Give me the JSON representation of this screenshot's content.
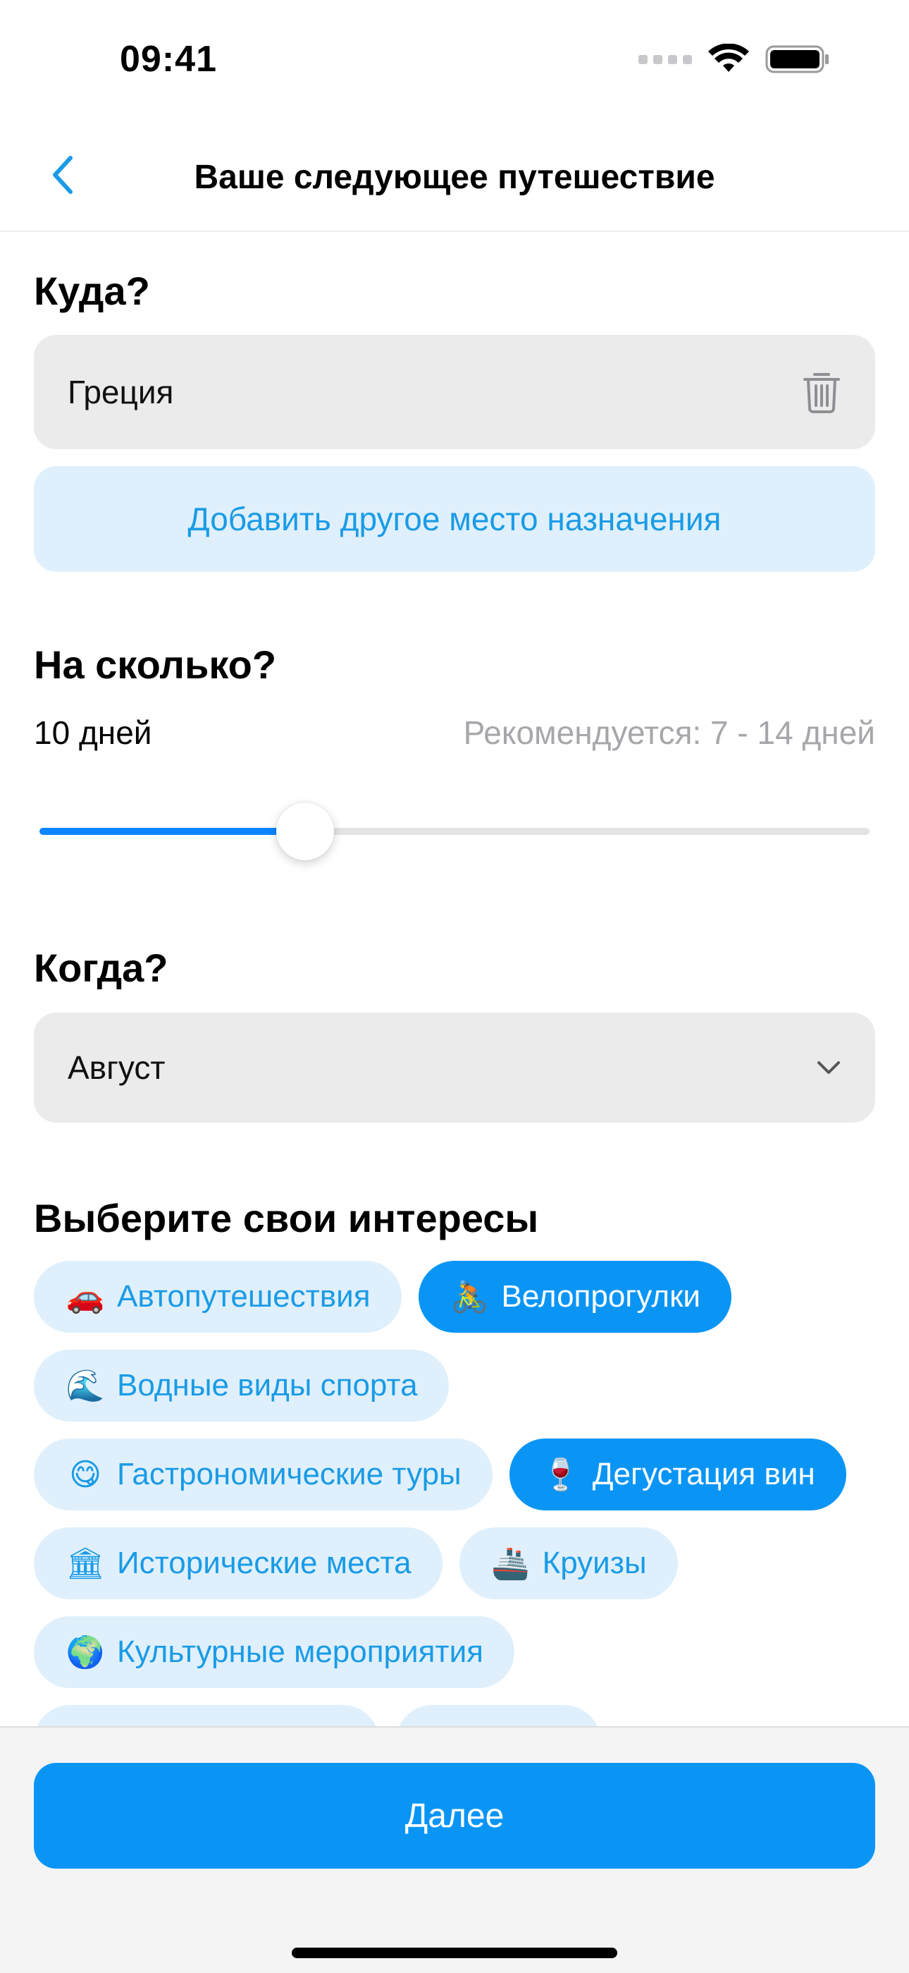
{
  "status_bar": {
    "time": "09:41",
    "signal_icon": "signal-dots-icon",
    "wifi_icon": "wifi-icon",
    "battery_icon": "battery-icon"
  },
  "header": {
    "back_icon": "chevron-left-icon",
    "title": "Ваше следующее путешествие",
    "accent_color": "#1a9be6"
  },
  "destination": {
    "label": "Куда?",
    "value": "Греция",
    "delete_icon": "trash-icon",
    "add_label": "Добавить другое место назначения"
  },
  "duration": {
    "label": "На сколько?",
    "value_text": "10 дней",
    "recommendation": "Рекомендуется: 7 - 14 дней",
    "slider_fraction": 0.32,
    "fill_color": "#0a84ff"
  },
  "when": {
    "label": "Когда?",
    "value": "Август",
    "dropdown_icon": "chevron-down-icon"
  },
  "interests": {
    "label": "Выберите свои интересы",
    "rows": [
      [
        {
          "emoji": "🚗",
          "label": "Автопутешествия",
          "selected": false
        },
        {
          "emoji": "🚴",
          "label": "Велопрогулки",
          "selected": true
        }
      ],
      [
        {
          "emoji": "🌊",
          "label": "Водные виды спорта",
          "selected": false
        }
      ],
      [
        {
          "emoji": "😋",
          "label": "Гастрономические туры",
          "selected": false
        },
        {
          "emoji": "🍷",
          "label": "Дегустация вин",
          "selected": true
        }
      ],
      [
        {
          "emoji": "🏛",
          "label": "Исторические места",
          "selected": false
        },
        {
          "emoji": "🚢",
          "label": "Круизы",
          "selected": false
        }
      ],
      [
        {
          "emoji": "🌍",
          "label": "Культурные мероприятия",
          "selected": false
        }
      ]
    ],
    "selected_color": "#0a95f5",
    "unselected_color": "#dff0fc"
  },
  "footer": {
    "next_label": "Далее"
  }
}
